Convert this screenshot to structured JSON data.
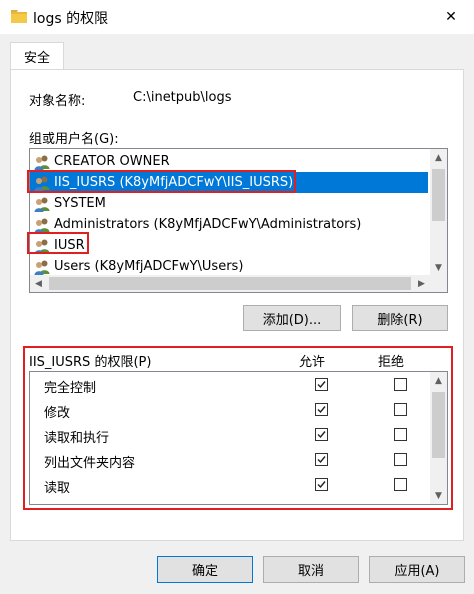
{
  "window": {
    "title": "logs 的权限",
    "close_glyph": "✕"
  },
  "tab": {
    "label": "安全"
  },
  "object": {
    "label": "对象名称:",
    "value": "C:\\inetpub\\logs"
  },
  "groups": {
    "label": "组或用户名(G):",
    "items": [
      {
        "label": "CREATOR OWNER",
        "selected": false,
        "highlighted": false
      },
      {
        "label": "IIS_IUSRS (K8yMfjADCFwY\\IIS_IUSRS)",
        "selected": true,
        "highlighted": true
      },
      {
        "label": "SYSTEM",
        "selected": false,
        "highlighted": false
      },
      {
        "label": "Administrators (K8yMfjADCFwY\\Administrators)",
        "selected": false,
        "highlighted": false
      },
      {
        "label": "IUSR",
        "selected": false,
        "highlighted": true
      },
      {
        "label": "Users (K8yMfjADCFwY\\Users)",
        "selected": false,
        "highlighted": false
      }
    ]
  },
  "buttons": {
    "add": "添加(D)...",
    "remove": "删除(R)"
  },
  "permissions": {
    "label": "IIS_IUSRS 的权限(P)",
    "allow_label": "允许",
    "deny_label": "拒绝",
    "items": [
      {
        "label": "完全控制",
        "allow": true,
        "deny": false
      },
      {
        "label": "修改",
        "allow": true,
        "deny": false
      },
      {
        "label": "读取和执行",
        "allow": true,
        "deny": false
      },
      {
        "label": "列出文件夹内容",
        "allow": true,
        "deny": false
      },
      {
        "label": "读取",
        "allow": true,
        "deny": false
      }
    ]
  },
  "footer": {
    "ok": "确定",
    "cancel": "取消",
    "apply": "应用(A)"
  },
  "colors": {
    "selection": "#0078d7",
    "highlight": "#e02020"
  }
}
